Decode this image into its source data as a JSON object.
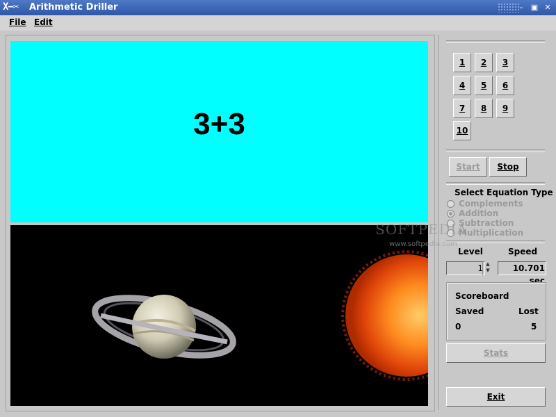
{
  "window": {
    "logo": "X−✂",
    "title": "Arithmetic Driller"
  },
  "menu": {
    "file": "File",
    "edit": "Edit"
  },
  "equation": "3+3",
  "numbers": [
    "1",
    "2",
    "3",
    "4",
    "5",
    "6",
    "7",
    "8",
    "9",
    "10"
  ],
  "controls": {
    "start": "Start",
    "stop": "Stop"
  },
  "equation_type": {
    "heading": "Select Equation Type",
    "options": [
      "Complements",
      "Addition",
      "Subtraction",
      "Multiplication"
    ],
    "selected": "Addition"
  },
  "level": {
    "label": "Level",
    "value": "1"
  },
  "speed": {
    "label": "Speed",
    "value": "10.701 sec"
  },
  "scoreboard": {
    "title": "Scoreboard",
    "saved_label": "Saved",
    "lost_label": "Lost",
    "saved": "0",
    "lost": "5"
  },
  "stats": "Stats",
  "exit": "Exit",
  "watermark": {
    "main": "SOFTPEDIA",
    "url": "www.softpedia.com"
  },
  "colors": {
    "equation_bg": "#00ffff",
    "title_bar": "#3a63b4",
    "space_bg": "#000000"
  }
}
